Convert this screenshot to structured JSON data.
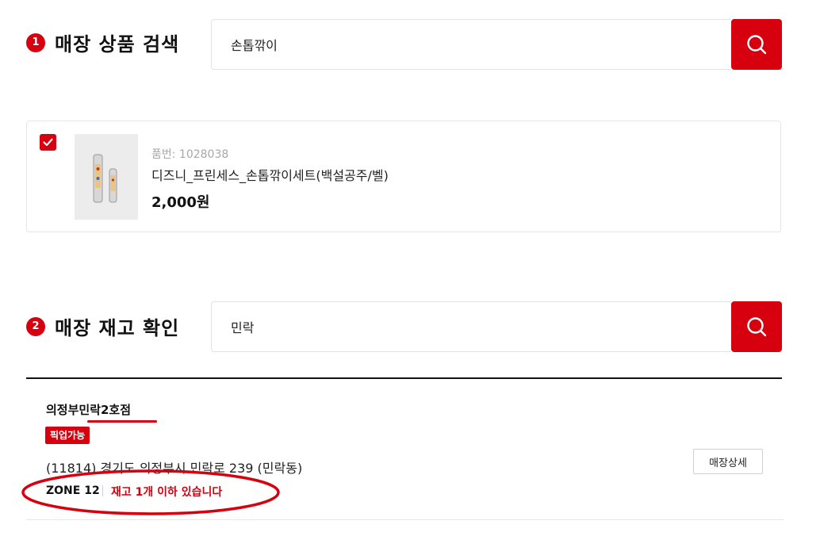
{
  "section1": {
    "step": "1",
    "title": "매장 상품 검색",
    "search_value": "손톱깎이"
  },
  "product": {
    "checked": true,
    "code": "품번: 1028038",
    "name": "디즈니_프린세스_손톱깎이세트(백설공주/벨)",
    "price": "2,000원"
  },
  "section2": {
    "step": "2",
    "title": "매장 재고 확인",
    "search_value": "민락"
  },
  "store": {
    "name": "의정부민락2호점",
    "badge": "픽업가능",
    "address": "(11814) 경기도 의정부시 민락로 239 (민락동)",
    "zone": "ZONE 12",
    "stock_message": "재고 1개 이하 있습니다",
    "detail_button": "매장상세"
  },
  "colors": {
    "accent": "#d7000f",
    "text": "#111111",
    "border": "#e6e6e6"
  },
  "icons": {
    "search": "search-icon",
    "check": "check-icon"
  }
}
